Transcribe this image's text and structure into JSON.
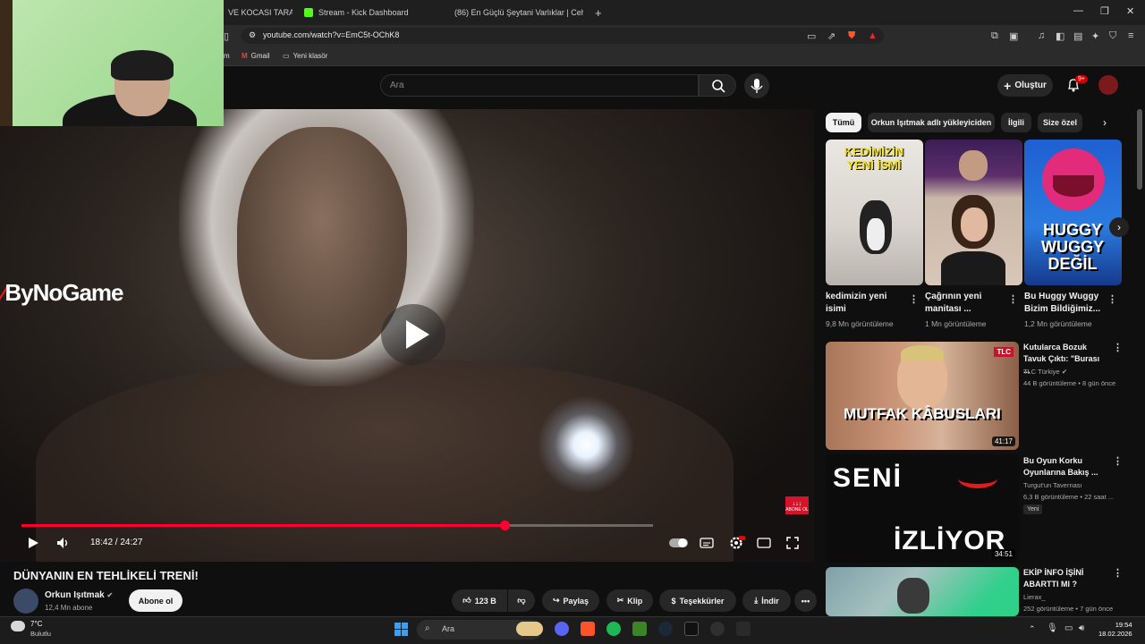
{
  "browser": {
    "tabs": [
      {
        "label": "VE KOCASI TARAF",
        "icon": "red"
      },
      {
        "label": "Stream - Kick Dashboard",
        "icon": "kick"
      },
      {
        "label": "(86) En Güçlü Şeytani Varlıklar | Ceh",
        "icon": "youtube"
      }
    ],
    "new_tab": "+",
    "url": "youtube.com/watch?v=EmC5t-OChK8",
    "bookmarks": [
      "m",
      "Gmail",
      "Yeni klasör"
    ]
  },
  "header": {
    "search_placeholder": "Ara",
    "create_label": "Oluştur",
    "notif_count": "9+"
  },
  "player": {
    "watermark": "ByNoGame",
    "time": "18:42 / 24:27",
    "progress": 0.765,
    "subscribe_badge": "ABONE OL"
  },
  "video": {
    "title": "DÜNYANIN EN TEHLİKELİ TRENİ!",
    "channel": "Orkun Işıtmak",
    "subs": "12,4 Mn abone",
    "subscribe_label": "Abone ol",
    "likes": "123 B",
    "share": "Paylaş",
    "clip": "Klip",
    "thanks": "Teşekkürler",
    "download": "İndir"
  },
  "chips": [
    "Tümü",
    "Orkun Işıtmak adlı yükleyiciden",
    "İlgili",
    "Size özel"
  ],
  "shorts": [
    {
      "title": "kedimizin yeni isimi",
      "views": "9,8 Mn görüntüleme",
      "overlay": "KEDİMİZİN YENİ İSMİ"
    },
    {
      "title": "Çağrının yeni manitası ...",
      "views": "1 Mn görüntüleme",
      "overlay": ""
    },
    {
      "title": "Bu Huggy Wuggy Bizim Bildiğimiz...",
      "views": "1,2 Mn görüntüleme",
      "overlay": "HUGGY WUGGY DEĞİL"
    }
  ],
  "related": [
    {
      "title": "Kutularca Bozuk Tavuk Çıktı: \"Burası ...",
      "channel": "TLC Türkiye",
      "meta": "44 B görüntüleme • 8 gün önce",
      "duration": "41:17",
      "thumb_text": "MUTFAK KÂBUSLARI",
      "badge": ""
    },
    {
      "title": "Bu Oyun Korku Oyunlarına Bakış ...",
      "channel": "Turgut'un Tavernası",
      "meta": "6,3 B görüntüleme • 22 saat ...",
      "duration": "34:51",
      "thumb_text_1": "SENİ",
      "thumb_text_2": "İZLİYOR",
      "badge": "Yeni"
    },
    {
      "title": "EKİP İNFO İŞİNİ ABARTTI MI ?",
      "channel": "Lierax_",
      "meta": "252 görüntüleme • 7 gün önce",
      "duration": "",
      "badge": ""
    }
  ],
  "taskbar": {
    "temp": "7°C",
    "weather": "Bulutlu",
    "search": "Ara",
    "time": "19:54",
    "date": "18.02.2026"
  }
}
